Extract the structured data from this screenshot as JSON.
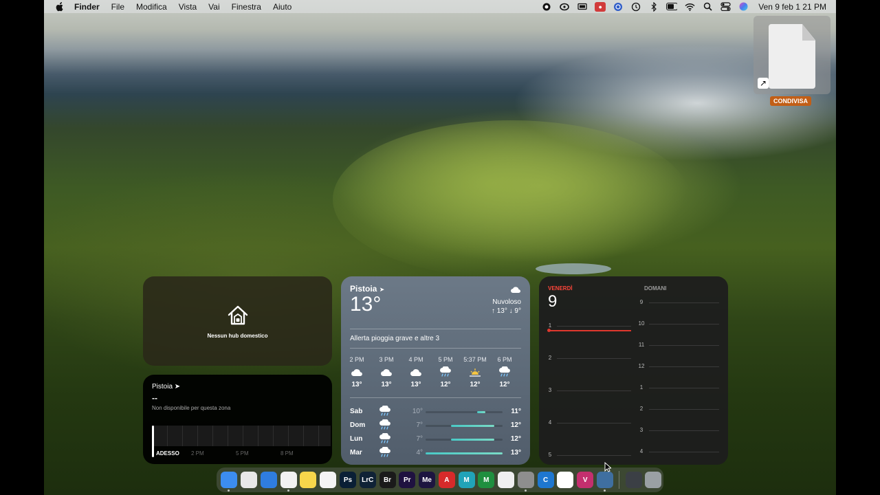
{
  "menubar": {
    "app_name": "Finder",
    "menus": [
      "File",
      "Modifica",
      "Vista",
      "Vai",
      "Finestra",
      "Aiuto"
    ],
    "clock": "Ven 9 feb  1 21 PM"
  },
  "desktop": {
    "file_label": "CONDIVISA"
  },
  "home_widget": {
    "message": "Nessun hub domestico"
  },
  "air_widget": {
    "location": "Pistoia",
    "value": "--",
    "subtitle": "Non disponibile per questa zona",
    "time_labels": [
      "ADESSO",
      "2 PM",
      "5 PM",
      "8 PM"
    ]
  },
  "weather_widget": {
    "city": "Pistoia",
    "temperature": "13°",
    "condition": "Nuvoloso",
    "high_low": "↑ 13° ↓ 9°",
    "alert": "Allerta pioggia grave e altre 3",
    "hourly": [
      {
        "time": "2 PM",
        "icon": "cloud-icon",
        "temp": "13°"
      },
      {
        "time": "3 PM",
        "icon": "cloud-icon",
        "temp": "13°"
      },
      {
        "time": "4 PM",
        "icon": "cloud-icon",
        "temp": "13°"
      },
      {
        "time": "5 PM",
        "icon": "rain-icon",
        "temp": "12°"
      },
      {
        "time": "5:37 PM",
        "icon": "sunset-icon",
        "temp": "12°"
      },
      {
        "time": "6 PM",
        "icon": "rain-icon",
        "temp": "12°"
      }
    ],
    "daily": [
      {
        "day": "Sab",
        "icon": "rain-icon",
        "low": "10°",
        "high": "11°"
      },
      {
        "day": "Dom",
        "icon": "rain-icon",
        "low": "7°",
        "high": "12°"
      },
      {
        "day": "Lun",
        "icon": "rain-icon",
        "low": "7°",
        "high": "12°"
      },
      {
        "day": "Mar",
        "icon": "rain-icon",
        "low": "4°",
        "high": "13°"
      }
    ]
  },
  "calendar_widget": {
    "weekday": "VENERDÌ",
    "day_number": "9",
    "tomorrow": "DOMANI",
    "today_hours": [
      "1",
      "2",
      "3",
      "4",
      "5"
    ],
    "tomorrow_hours": [
      "9",
      "10",
      "11",
      "12",
      "1",
      "2",
      "3",
      "4"
    ]
  },
  "dock": {
    "apps": [
      {
        "name": "finder-icon",
        "label": "",
        "color": "#3c8df0"
      },
      {
        "name": "launchpad-icon",
        "label": "",
        "color": "#e8e8e8"
      },
      {
        "name": "safari-icon",
        "label": "",
        "color": "#2f7de0"
      },
      {
        "name": "chrome-icon",
        "label": "",
        "color": "#f2f2f2"
      },
      {
        "name": "notes-icon",
        "label": "",
        "color": "#f7d64b"
      },
      {
        "name": "freeform-icon",
        "label": "",
        "color": "#f4f4f4"
      },
      {
        "name": "photoshop-icon",
        "label": "Ps",
        "color": "#0a1f35"
      },
      {
        "name": "lightroom-classic-icon",
        "label": "LrC",
        "color": "#0f2236"
      },
      {
        "name": "bridge-icon",
        "label": "Br",
        "color": "#1a1a1a"
      },
      {
        "name": "premiere-icon",
        "label": "Pr",
        "color": "#1f1240"
      },
      {
        "name": "media-encoder-icon",
        "label": "Me",
        "color": "#1d1540"
      },
      {
        "name": "app-a-icon",
        "label": "A",
        "color": "#d72a2a"
      },
      {
        "name": "app-m-teal-icon",
        "label": "M",
        "color": "#21a3b8"
      },
      {
        "name": "app-m-green-icon",
        "label": "M",
        "color": "#1f8f3f"
      },
      {
        "name": "document-icon",
        "label": "",
        "color": "#f0f0f0"
      },
      {
        "name": "system-settings-icon",
        "label": "",
        "color": "#8e8e8e"
      },
      {
        "name": "cursor-app-icon",
        "label": "C",
        "color": "#1e77d0"
      },
      {
        "name": "airbnb-icon",
        "label": "",
        "color": "#ffffff"
      },
      {
        "name": "app-vr-icon",
        "label": "V",
        "color": "#c42f6e"
      },
      {
        "name": "quicktime-icon",
        "label": "",
        "color": "#3f6fa0"
      }
    ],
    "trailing": [
      {
        "name": "downloads-stack-icon",
        "color": "#3b3f45"
      },
      {
        "name": "trash-icon",
        "color": "#9aa0a4"
      }
    ]
  }
}
